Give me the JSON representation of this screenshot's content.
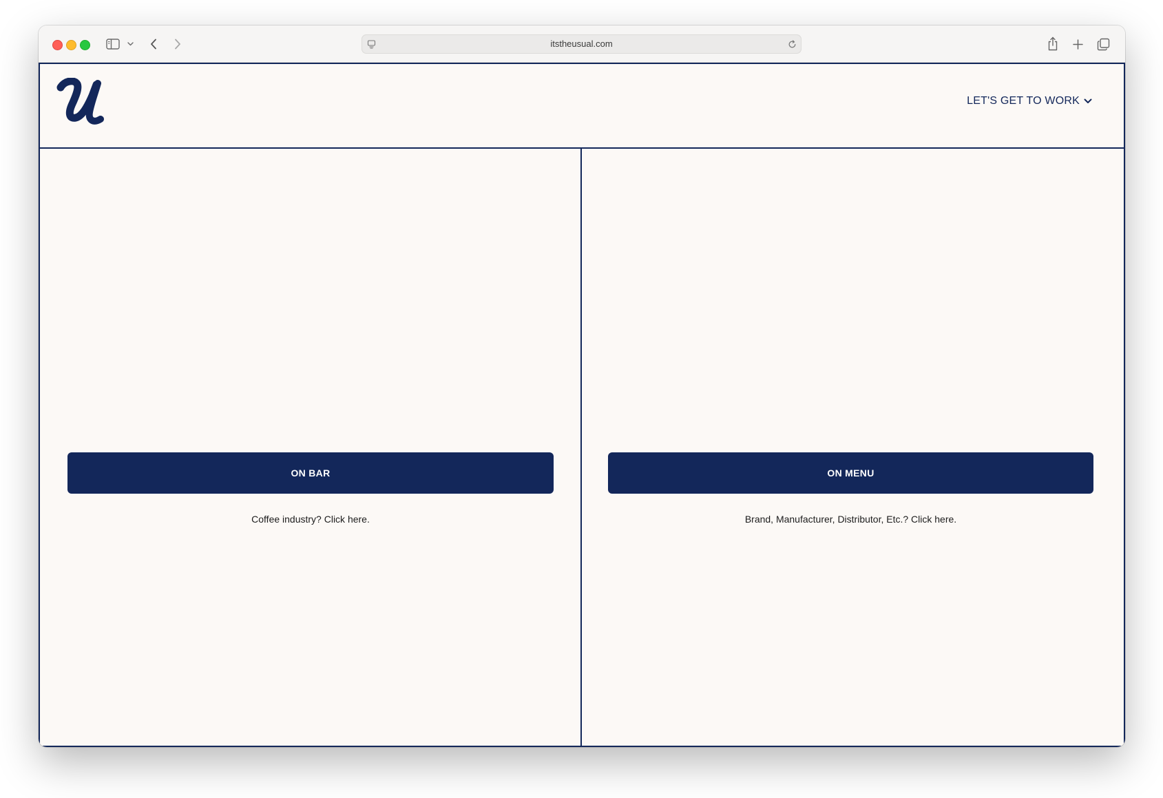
{
  "browser": {
    "url": "itstheusual.com"
  },
  "site": {
    "logo_icon": "script-u-logo",
    "nav_cta_label": "LET'S GET TO WORK",
    "nav_cta_icon": "chevron-down-icon"
  },
  "panels": [
    {
      "button_label": "ON BAR",
      "caption": "Coffee industry? Click here."
    },
    {
      "button_label": "ON MENU",
      "caption": "Brand, Manufacturer, Distributor, Etc.? Click here."
    }
  ],
  "colors": {
    "brand_navy": "#13275a",
    "page_background": "#fcf9f6"
  }
}
